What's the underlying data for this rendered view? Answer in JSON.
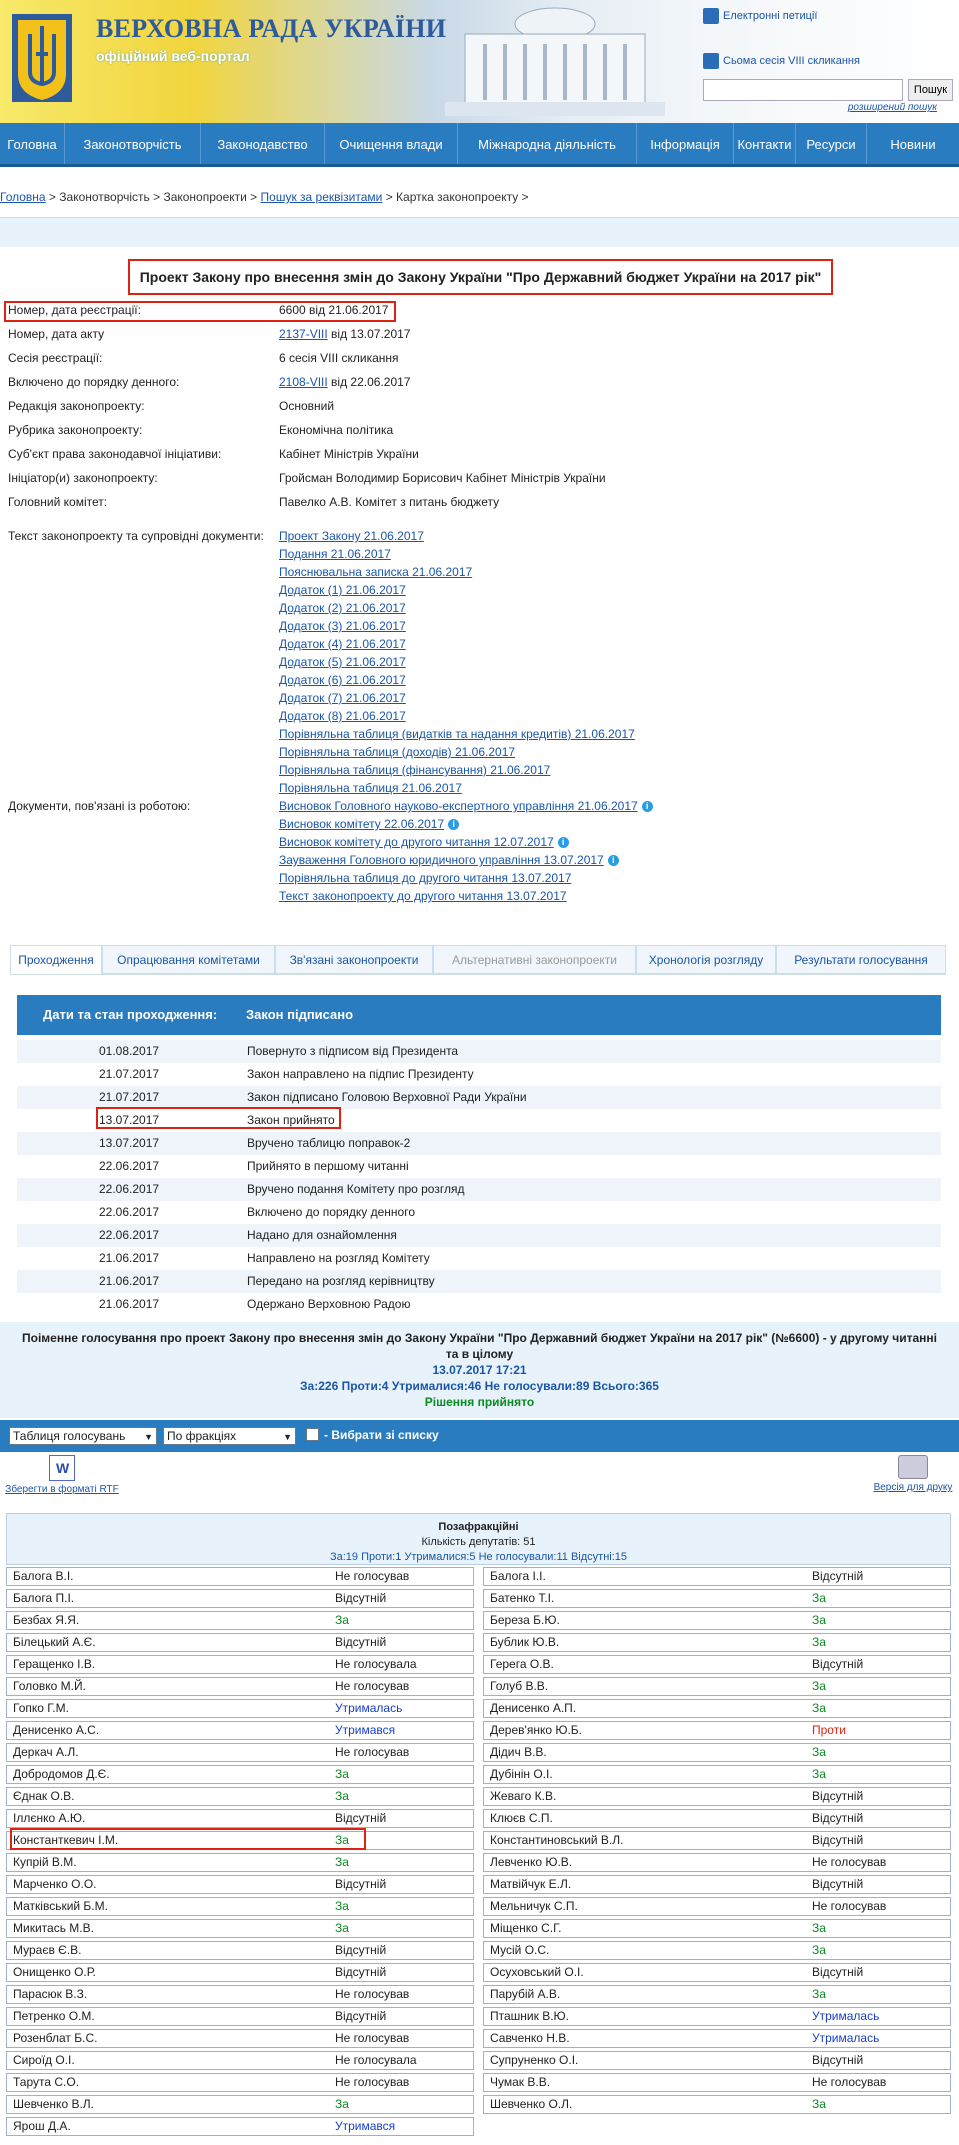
{
  "header": {
    "title": "ВЕРХОВНА РАДА УКРАЇНИ",
    "subtitle": "офіційний веб-портал",
    "petitions": "Електронні петиції",
    "session": "Сьома сесія VIII скликання",
    "search_button": "Пошук",
    "advanced_search": "розширений пошук"
  },
  "nav": [
    "Головна",
    "Законотворчість",
    "Законодавство",
    "Очищення влади",
    "Міжнародна діяльність",
    "Інформація",
    "Контакти",
    "Ресурси",
    "Новини"
  ],
  "breadcrumb": {
    "home": "Головна",
    "s1": " > Законотворчість > Законопроекти > ",
    "search": "Пошук за реквізитами",
    "s2": " > Картка законопроекту >"
  },
  "bill": {
    "title": "Проект Закону про внесення змін до Закону України \"Про Державний бюджет України на 2017 рік\"",
    "fields": [
      {
        "label": "Номер, дата реєстрації:",
        "value": "6600 від 21.06.2017"
      },
      {
        "label": "Номер, дата акту",
        "link": "2137-VIII",
        "rest": " від 13.07.2017"
      },
      {
        "label": "Сесія реєстрації:",
        "value": "6 сесія VIII скликання"
      },
      {
        "label": "Включено до порядку денного:",
        "link": "2108-VIII",
        "rest": "  від 22.06.2017"
      },
      {
        "label": "Редакція законопроекту:",
        "value": "Основний"
      },
      {
        "label": "Рубрика законопроекту:",
        "value": "Економічна політика"
      },
      {
        "label": "Суб'єкт права законодавчої ініціативи:",
        "value": "Кабінет Міністрів України"
      },
      {
        "label": "Ініціатор(и) законопроекту:",
        "value": "Гройсман Володимир Борисович Кабінет Міністрів України"
      },
      {
        "label": "Головний комітет:",
        "value": "Павелко А.В. Комітет з питань бюджету"
      }
    ],
    "docs_label": "Текст законопроекту та супровідні документи:",
    "docs": [
      "Проект Закону 21.06.2017",
      "Подання 21.06.2017",
      "Пояснювальна записка 21.06.2017",
      "Додаток (1) 21.06.2017",
      "Додаток (2) 21.06.2017",
      "Додаток (3) 21.06.2017",
      "Додаток (4) 21.06.2017",
      "Додаток (5) 21.06.2017",
      "Додаток (6) 21.06.2017",
      "Додаток (7) 21.06.2017",
      "Додаток (8) 21.06.2017",
      "Порівняльна таблиця (видатків та надання кредитів) 21.06.2017",
      "Порівняльна таблиця (доходів) 21.06.2017",
      "Порівняльна таблиця (фінансування) 21.06.2017",
      "Порівняльна таблиця 21.06.2017"
    ],
    "related_label": "Документи, пов'язані із роботою:",
    "related": [
      "Висновок Головного науково-експертного управління 21.06.2017",
      "Висновок комітету 22.06.2017",
      "Висновок комітету до другого читання 12.07.2017",
      "Зауваження Головного юридичного управління 13.07.2017",
      "Порівняльна таблиця до другого читання 13.07.2017",
      "Текст законопроекту до другого читання 13.07.2017"
    ],
    "info_mark": "i"
  },
  "tabs": [
    "Проходження",
    "Опрацювання комітетами",
    "Зв'язані законопроекти",
    "Альтернативні законопроекти",
    "Хронологія розгляду",
    "Результати голосування"
  ],
  "stages": {
    "header_label": "Дати та стан проходження:",
    "header_status": "Закон підписано",
    "rows": [
      [
        "01.08.2017",
        "Повернуто з підписом від Президента"
      ],
      [
        "21.07.2017",
        "Закон направлено на підпис Президенту"
      ],
      [
        "21.07.2017",
        "Закон підписано Головою Верховної Ради України"
      ],
      [
        "13.07.2017",
        "Закон прийнято"
      ],
      [
        "13.07.2017",
        "Вручено таблицю поправок-2"
      ],
      [
        "22.06.2017",
        "Прийнято в першому читанні"
      ],
      [
        "22.06.2017",
        "Вручено подання Комітету про розгляд"
      ],
      [
        "22.06.2017",
        "Включено до порядку денного"
      ],
      [
        "22.06.2017",
        "Надано для ознайомлення"
      ],
      [
        "21.06.2017",
        "Направлено на розгляд Комітету"
      ],
      [
        "21.06.2017",
        "Передано на розгляд керівництву"
      ],
      [
        "21.06.2017",
        "Одержано Верховною Радою"
      ]
    ]
  },
  "vote": {
    "title": "Поіменне голосування про проект Закону про внесення змін до Закону України \"Про Державний бюджет України на 2017 рік\" (№6600) - у другому читанні та в цілому",
    "datetime": "13.07.2017 17:21",
    "totals": "За:226 Проти:4 Утрималися:46 Не голосували:89 Всього:365",
    "decision": "Рішення прийнято",
    "filter1": "Таблиця голосувань",
    "filter2": "По фракціях",
    "filter_check": "- Вибрати зі списку",
    "save_rtf": "Зберегти в форматі RTF",
    "print": "Версія для друку",
    "rtf_glyph": "W",
    "faction": {
      "name": "Позафракційні",
      "count": "Кількість депутатів: 51",
      "totals": "За:19 Проти:1 Утрималися:5 Не голосували:11 Відсутні:15"
    },
    "left": [
      [
        "Балога В.І.",
        "Не голосував"
      ],
      [
        "Балога П.І.",
        "Відсутній"
      ],
      [
        "Безбах Я.Я.",
        "За"
      ],
      [
        "Білецький А.Є.",
        "Відсутній"
      ],
      [
        "Геращенко І.В.",
        "Не голосувала"
      ],
      [
        "Головко М.Й.",
        "Не голосував"
      ],
      [
        "Гопко Г.М.",
        "Утрималась"
      ],
      [
        "Денисенко А.С.",
        "Утримався"
      ],
      [
        "Деркач А.Л.",
        "Не голосував"
      ],
      [
        "Добродомов Д.Є.",
        "За"
      ],
      [
        "Єднак О.В.",
        "За"
      ],
      [
        "Іллєнко А.Ю.",
        "Відсутній"
      ],
      [
        "Константкевич І.М.",
        "За"
      ],
      [
        "Купрій В.М.",
        "За"
      ],
      [
        "Марченко О.О.",
        "Відсутній"
      ],
      [
        "Матківський Б.М.",
        "За"
      ],
      [
        "Микитась М.В.",
        "За"
      ],
      [
        "Мураєв Є.В.",
        "Відсутній"
      ],
      [
        "Онищенко О.Р.",
        "Відсутній"
      ],
      [
        "Парасюк В.З.",
        "Не голосував"
      ],
      [
        "Петренко О.М.",
        "Відсутній"
      ],
      [
        "Розенблат Б.С.",
        "Не голосував"
      ],
      [
        "Сироїд О.І.",
        "Не голосувала"
      ],
      [
        "Тарута С.О.",
        "Не голосував"
      ],
      [
        "Шевченко В.Л.",
        "За"
      ],
      [
        "Ярош Д.А.",
        "Утримався"
      ]
    ],
    "right": [
      [
        "Балога І.І.",
        "Відсутній"
      ],
      [
        "Батенко Т.І.",
        "За"
      ],
      [
        "Береза Б.Ю.",
        "За"
      ],
      [
        "Бублик Ю.В.",
        "За"
      ],
      [
        "Герега О.В.",
        "Відсутній"
      ],
      [
        "Голуб В.В.",
        "За"
      ],
      [
        "Денисенко А.П.",
        "За"
      ],
      [
        "Дерев'янко Ю.Б.",
        "Проти"
      ],
      [
        "Дідич В.В.",
        "За"
      ],
      [
        "Дубінін О.І.",
        "За"
      ],
      [
        "Жеваго К.В.",
        "Відсутній"
      ],
      [
        "Клюєв С.П.",
        "Відсутній"
      ],
      [
        "Константиновський В.Л.",
        "Відсутній"
      ],
      [
        "Левченко Ю.В.",
        "Не голосував"
      ],
      [
        "Матвійчук Е.Л.",
        "Відсутній"
      ],
      [
        "Мельничук С.П.",
        "Не голосував"
      ],
      [
        "Міщенко С.Г.",
        "За"
      ],
      [
        "Мусій О.С.",
        "За"
      ],
      [
        "Осуховський О.І.",
        "Відсутній"
      ],
      [
        "Парубій А.В.",
        "За"
      ],
      [
        "Пташник В.Ю.",
        "Утрималась"
      ],
      [
        "Савченко Н.В.",
        "Утрималась"
      ],
      [
        "Супруненко О.І.",
        "Відсутній"
      ],
      [
        "Чумак В.В.",
        "Не голосував"
      ],
      [
        "Шевченко О.Л.",
        "За"
      ]
    ]
  },
  "colors": {
    "nav": "#2a7cc0",
    "highlight": "#dd2211",
    "for": "#0a8a20",
    "abstain": "#1a3fc8",
    "against": "#dd2211"
  }
}
